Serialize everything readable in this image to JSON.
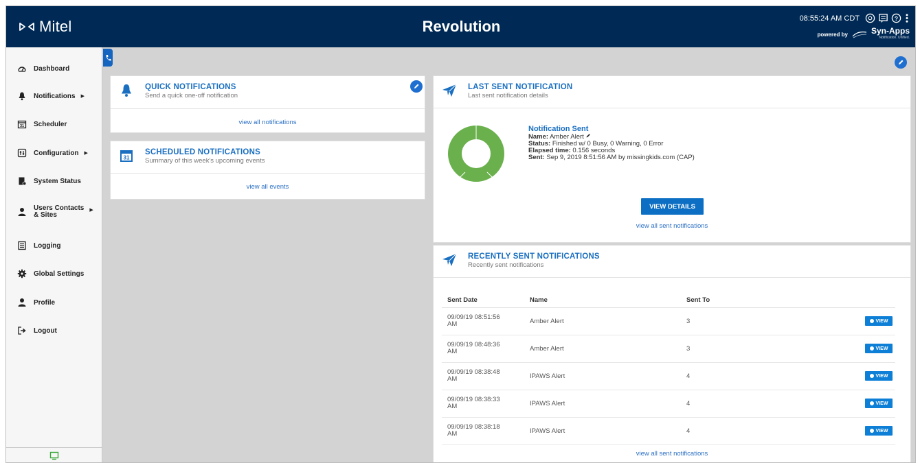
{
  "header": {
    "logo_text": "Mitel",
    "app_title": "Revolution",
    "clock": "08:55:24 AM CDT",
    "powered_by": "powered by",
    "brand": "Syn-Apps",
    "brand_tagline": "Notification. Unified.",
    "icons": [
      "help-circle-icon",
      "messages-icon",
      "question-icon",
      "more-vertical-icon"
    ]
  },
  "sidebar": {
    "items": [
      {
        "label": "Dashboard",
        "icon": "dashboard-icon",
        "arrow": false
      },
      {
        "label": "Notifications",
        "icon": "bell-icon",
        "arrow": true
      },
      {
        "label": "Scheduler",
        "icon": "calendar-icon",
        "arrow": false
      },
      {
        "label": "Configuration",
        "icon": "configuration-icon",
        "arrow": true
      },
      {
        "label": "System Status",
        "icon": "system-status-icon",
        "arrow": false
      },
      {
        "label_line1": "Users Contacts",
        "label_line2": "& Sites",
        "icon": "user-icon",
        "arrow": true
      },
      {
        "label": "Logging",
        "icon": "log-icon",
        "arrow": false
      },
      {
        "label": "Global Settings",
        "icon": "gear-icon",
        "arrow": false
      },
      {
        "label": "Profile",
        "icon": "profile-icon",
        "arrow": false
      },
      {
        "label": "Logout",
        "icon": "logout-icon",
        "arrow": false
      }
    ],
    "footer_icon": "monitor-icon"
  },
  "quick": {
    "title": "QUICK NOTIFICATIONS",
    "subtitle": "Send a quick one-off notification",
    "link": "view all notifications"
  },
  "scheduled": {
    "title": "SCHEDULED NOTIFICATIONS",
    "subtitle": "Summary of this week's upcoming events",
    "link": "view all events"
  },
  "last_sent": {
    "title": "LAST SENT NOTIFICATION",
    "subtitle": "Last sent notification details",
    "status_title": "Notification Sent",
    "name_label": "Name:",
    "name_value": "Amber Alert",
    "status_label": "Status:",
    "status_value": "Finished w/ 0 Busy, 0 Warning, 0 Error",
    "elapsed_label": "Elapsed time:",
    "elapsed_value": "0.156 seconds",
    "sent_label": "Sent:",
    "sent_value": "Sep 9, 2019 8:51:56 AM by missingkids.com (CAP)",
    "button": "VIEW DETAILS",
    "link": "view all sent notifications",
    "donut_color": "#6ab04c"
  },
  "recent": {
    "title": "RECENTLY SENT NOTIFICATIONS",
    "subtitle": "Recently sent notifications",
    "columns": [
      "Sent Date",
      "Name",
      "Sent To"
    ],
    "rows": [
      {
        "date_line1": "09/09/19 08:51:56",
        "date_line2": "AM",
        "name": "Amber Alert",
        "sent_to": "3",
        "action": "VIEW"
      },
      {
        "date_line1": "09/09/19 08:48:36",
        "date_line2": "AM",
        "name": "Amber Alert",
        "sent_to": "3",
        "action": "VIEW"
      },
      {
        "date_line1": "09/09/19 08:38:48",
        "date_line2": "AM",
        "name": "IPAWS Alert",
        "sent_to": "4",
        "action": "VIEW"
      },
      {
        "date_line1": "09/09/19 08:38:33",
        "date_line2": "AM",
        "name": "IPAWS Alert",
        "sent_to": "4",
        "action": "VIEW"
      },
      {
        "date_line1": "09/09/19 08:38:18",
        "date_line2": "AM",
        "name": "IPAWS Alert",
        "sent_to": "4",
        "action": "VIEW"
      }
    ],
    "link": "view all sent notifications"
  },
  "colors": {
    "header_bg": "#002a55",
    "accent": "#1a6fc0",
    "button": "#0d6fc4",
    "donut": "#6ab04c"
  }
}
